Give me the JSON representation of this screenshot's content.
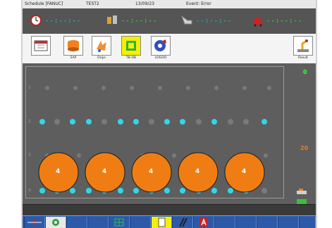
{
  "titlebar": {
    "app": "Schedule [FANUC]",
    "machine": "TEST2",
    "date": "13/09/23",
    "event": "Event: Error"
  },
  "status": {
    "timer": "--:--:--",
    "parts": "--:--:--",
    "spindle": "--:--:--",
    "robot": "--:--:--"
  },
  "toolbar": {
    "buttons": [
      {
        "label": ""
      },
      {
        "label": "SAP"
      },
      {
        "label": "Drips"
      },
      {
        "label": "TB-OB"
      },
      {
        "label": "LOGOO"
      },
      {
        "label": "Result"
      }
    ]
  },
  "workarea": {
    "row_labels": [
      "1",
      "2",
      "3",
      "4"
    ],
    "circles": [
      {
        "label": "4"
      },
      {
        "label": "4"
      },
      {
        "label": "4"
      },
      {
        "label": "4"
      },
      {
        "label": "4"
      }
    ],
    "right_top_value": "0",
    "right_mid_value": "20"
  },
  "colors": {
    "accent_orange": "#f07d14",
    "indicator_cyan": "#33d6e8",
    "background_gray": "#5e5e5e",
    "taskbar_blue": "#2c5aa8"
  }
}
